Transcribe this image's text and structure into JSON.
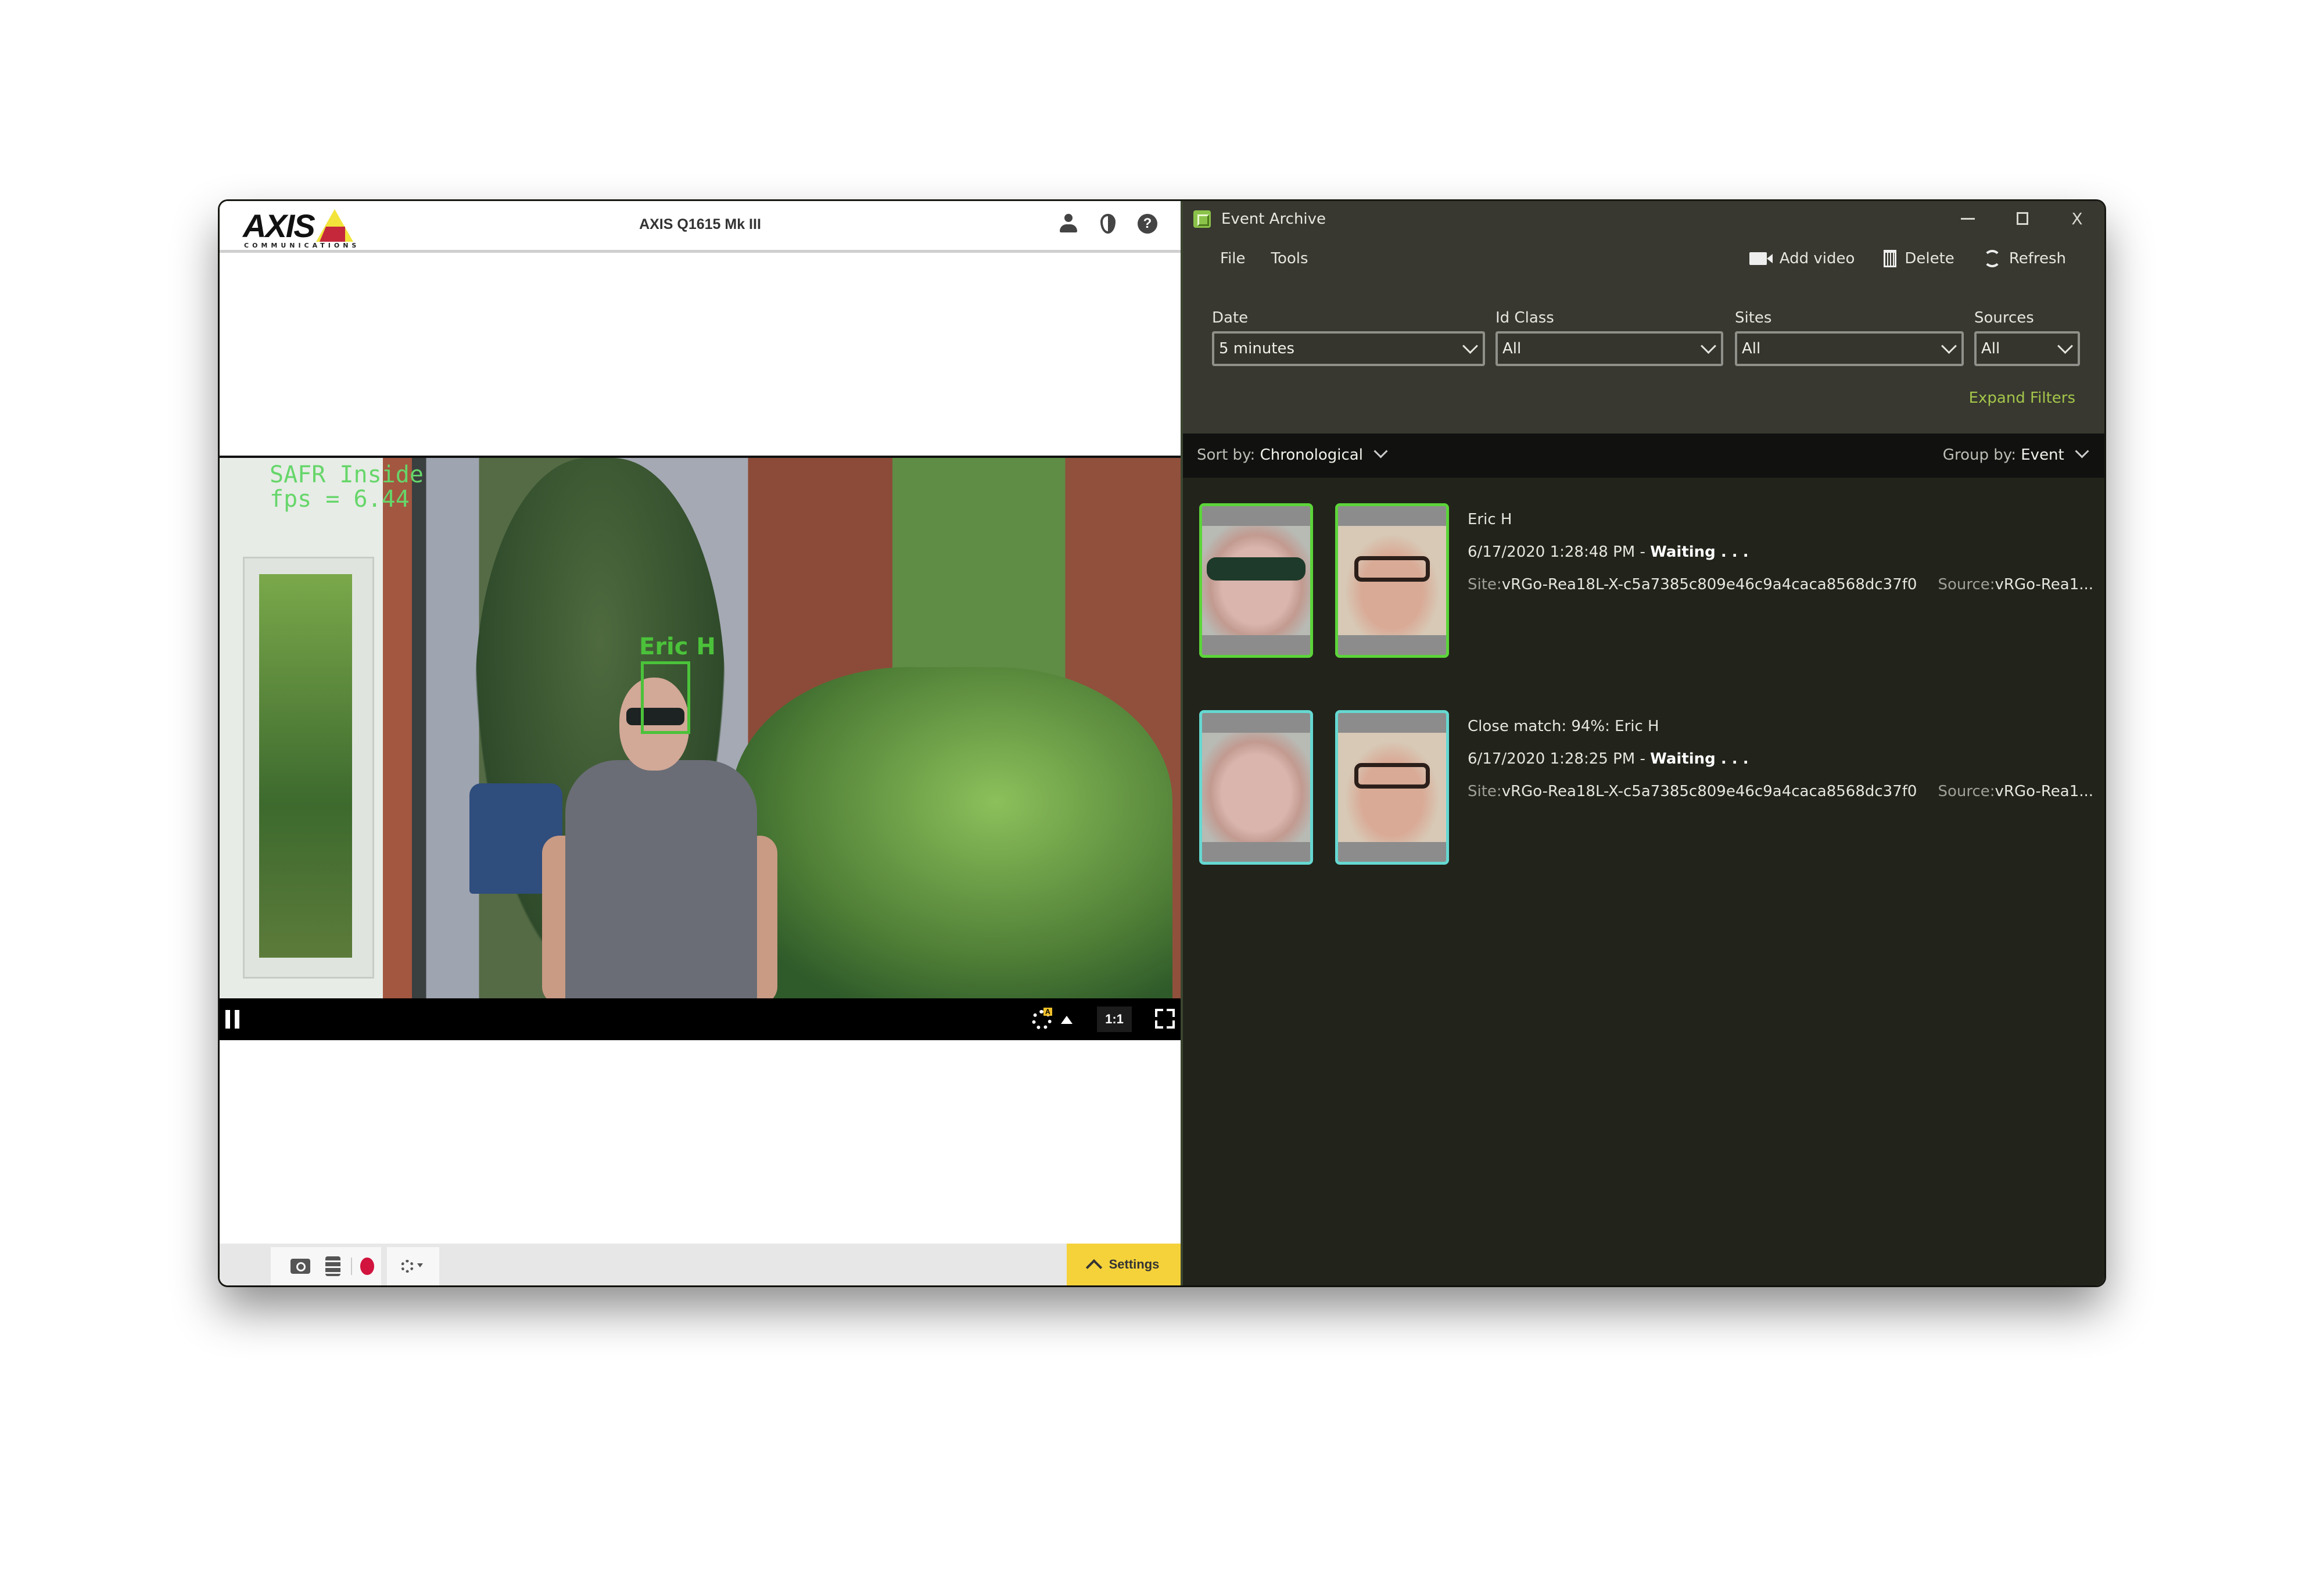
{
  "axis_window": {
    "logo_word": "AXIS",
    "logo_sub": "COMMUNICATIONS",
    "title": "AXIS Q1615 Mk III",
    "header_icons": [
      "user-icon",
      "contrast-icon",
      "help-icon"
    ],
    "help_glyph": "?",
    "video_overlay": {
      "brand_line": "SAFR Inside",
      "fps_line": "fps = 6.44",
      "face_label": "Eric H",
      "overlay_color": "#66d66a"
    },
    "video_controls": {
      "play_state": "paused",
      "auto_badge": "A",
      "ratio_label": "1:1"
    },
    "toolbar": {
      "settings_label": "Settings",
      "accent": "#f5d23a",
      "record_color": "#d1133d"
    }
  },
  "event_archive": {
    "title": "Event Archive",
    "window_controls": {
      "close_glyph": "X"
    },
    "menu": [
      "File",
      "Tools"
    ],
    "actions": {
      "add_video": "Add video",
      "delete": "Delete",
      "refresh": "Refresh"
    },
    "filters": {
      "date": {
        "label": "Date",
        "value": "5 minutes"
      },
      "id_class": {
        "label": "Id Class",
        "value": "All"
      },
      "sites": {
        "label": "Sites",
        "value": "All"
      },
      "sources": {
        "label": "Sources",
        "value": "All"
      },
      "expand_label": "Expand Filters"
    },
    "sort": {
      "prefix": "Sort by:",
      "value": "Chronological"
    },
    "group": {
      "prefix": "Group by:",
      "value": "Event"
    },
    "accent": "#a4c64a",
    "events": [
      {
        "title": "Eric H",
        "time": "6/17/2020 1:28:48 PM -",
        "status": "Waiting . . .",
        "site_label": "Site:",
        "site": "vRGo-Rea18L-X-c5a7385c809e46c9a4caca8568dc37f0",
        "source_label": "Source:",
        "source": "vRGo-Rea1...",
        "border_color": "#5cd43a"
      },
      {
        "title": "Close match: 94%: Eric H",
        "time": "6/17/2020 1:28:25 PM -",
        "status": "Waiting . . .",
        "site_label": "Site:",
        "site": "vRGo-Rea18L-X-c5a7385c809e46c9a4caca8568dc37f0",
        "source_label": "Source:",
        "source": "vRGo-Rea1...",
        "border_color": "#65d8d1"
      }
    ]
  }
}
